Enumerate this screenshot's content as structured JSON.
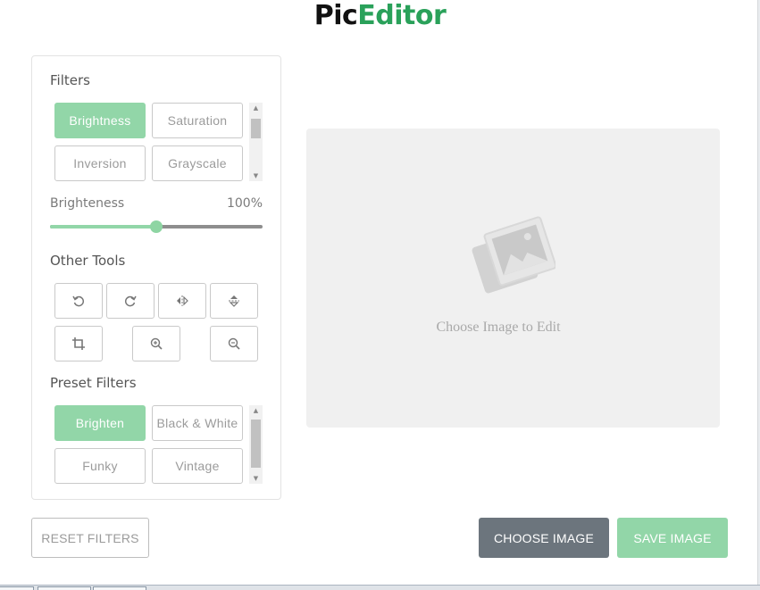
{
  "app": {
    "title_part1": "Pic",
    "title_part2": "Editor"
  },
  "filters": {
    "title": "Filters",
    "options": [
      "Brightness",
      "Saturation",
      "Inversion",
      "Grayscale"
    ],
    "active": "Brightness"
  },
  "slider": {
    "label": "Brighteness",
    "value_text": "100%",
    "value_fraction": 0.5
  },
  "other_tools": {
    "title": "Other Tools",
    "icons": [
      "rotate-left-icon",
      "rotate-right-icon",
      "flip-horizontal-icon",
      "flip-vertical-icon",
      "crop-icon",
      "zoom-in-icon",
      "zoom-out-icon"
    ]
  },
  "preset_filters": {
    "title": "Preset Filters",
    "options": [
      "Brighten",
      "Black & White",
      "Funky",
      "Vintage"
    ],
    "active": "Brighten"
  },
  "preview": {
    "placeholder": "Choose Image to Edit",
    "icon": "image-placeholder-icon"
  },
  "actions": {
    "reset": "RESET FILTERS",
    "choose": "CHOOSE IMAGE",
    "save": "SAVE IMAGE"
  },
  "colors": {
    "accent": "#92d6a8",
    "brand_green": "#2aa15a",
    "choose_btn": "#6c757d",
    "preview_bg": "#f0f0f0"
  }
}
